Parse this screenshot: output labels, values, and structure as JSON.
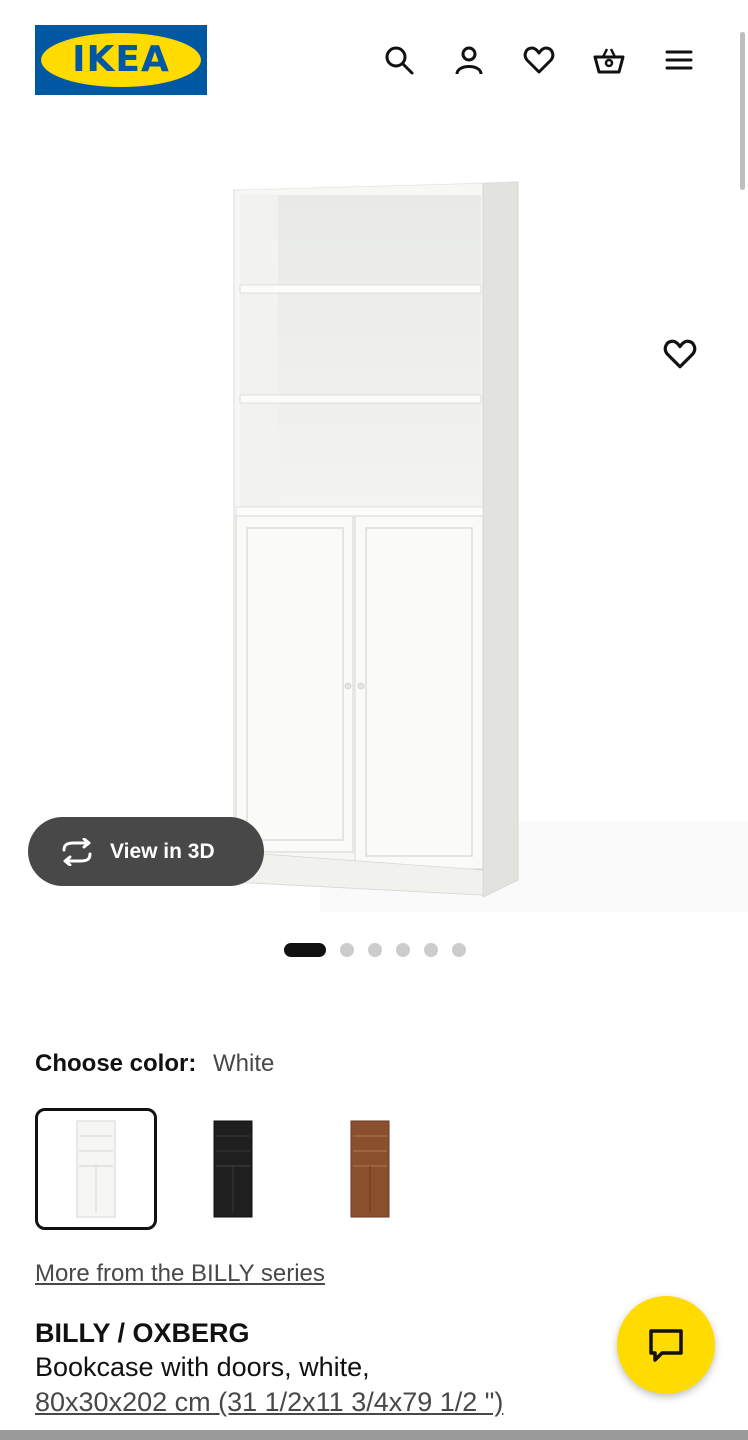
{
  "header": {
    "logo_text": "IKEA",
    "logo_registered": "®",
    "icons": [
      "search-icon",
      "user-icon",
      "heart-icon",
      "basket-icon",
      "menu-icon"
    ]
  },
  "gallery": {
    "view_3d_label": "View in 3D",
    "image_count": 6,
    "active_image": 1
  },
  "color_picker": {
    "label": "Choose color:",
    "selected_value": "White",
    "options": [
      "white",
      "black",
      "brown"
    ]
  },
  "series_link": "More from the BILLY series",
  "product": {
    "name": "BILLY / OXBERG",
    "description": "Bookcase with doors, white,",
    "size": "80x30x202 cm (31 1/2x11 3/4x79 1/2 \")"
  },
  "colors": {
    "ikea_blue": "#0058a3",
    "ikea_yellow": "#ffdb00",
    "dark_button": "#484848"
  }
}
